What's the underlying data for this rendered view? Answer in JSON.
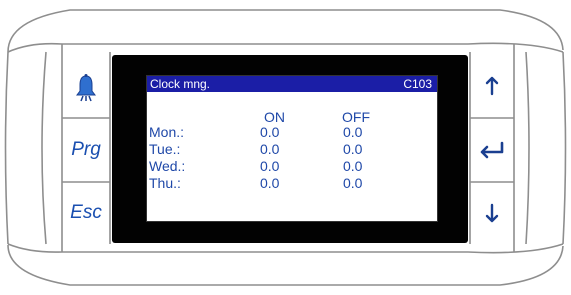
{
  "left_buttons": {
    "alarm_icon": "bell-icon",
    "prg_label": "Prg",
    "esc_label": "Esc"
  },
  "right_buttons": {
    "up_icon": "arrow-up-icon",
    "enter_icon": "enter-icon",
    "down_icon": "arrow-down-icon"
  },
  "screen": {
    "title": "Clock mng.",
    "code": "C103",
    "columns": {
      "on": "ON",
      "off": "OFF"
    },
    "rows": [
      {
        "day": "Mon.:",
        "on": "0.0",
        "off": "0.0"
      },
      {
        "day": "Tue.:",
        "on": "0.0",
        "off": "0.0"
      },
      {
        "day": "Wed.:",
        "on": "0.0",
        "off": "0.0"
      },
      {
        "day": "Thu.:",
        "on": "0.0",
        "off": "0.0"
      }
    ]
  },
  "colors": {
    "header_bg": "#1b1ea6",
    "text": "#1f48a8",
    "button_label": "#1a4fb0",
    "bezel": "#020202"
  }
}
